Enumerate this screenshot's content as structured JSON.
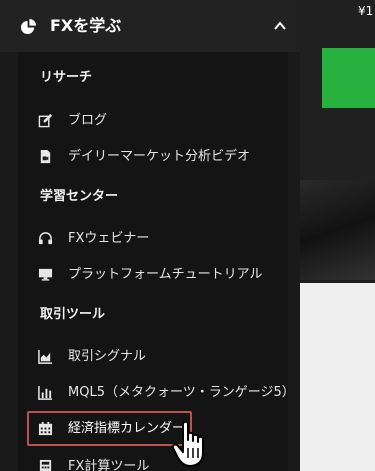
{
  "header": {
    "title": "FXを学ぶ",
    "icon": "pie-chart-icon",
    "toggle_icon": "chevron-up-icon"
  },
  "price_text": "¥1",
  "colors": {
    "accent_green": "#27b23f",
    "highlight_border": "#c0504d",
    "panel_bg": "#1a1a1a"
  },
  "sections": [
    {
      "title": "リサーチ",
      "items": [
        {
          "label": "ブログ",
          "icon": "edit-icon"
        },
        {
          "label": "デイリーマーケット分析ビデオ",
          "icon": "video-file-icon"
        }
      ]
    },
    {
      "title": "学習センター",
      "items": [
        {
          "label": "FXウェビナー",
          "icon": "headphones-icon"
        },
        {
          "label": "プラットフォームチュートリアル",
          "icon": "monitor-icon"
        }
      ]
    },
    {
      "title": "取引ツール",
      "items": [
        {
          "label": "取引シグナル",
          "icon": "area-chart-icon"
        },
        {
          "label": "MQL5（メタクォーツ・ランゲージ5）",
          "icon": "bar-chart-icon"
        },
        {
          "label": "経済指標カレンダー",
          "icon": "calendar-icon",
          "highlighted": true
        },
        {
          "label": "FX計算ツール",
          "icon": "calculator-icon"
        }
      ]
    }
  ]
}
